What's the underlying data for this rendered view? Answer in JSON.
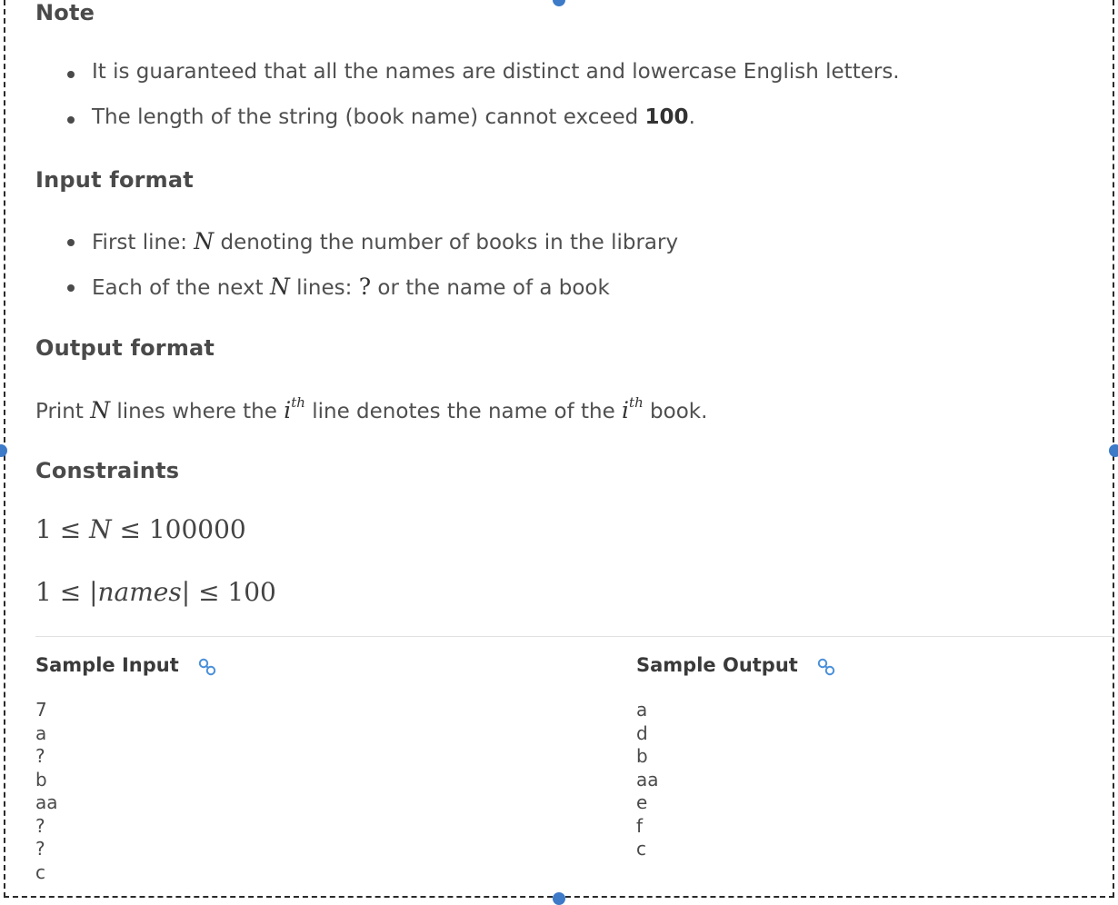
{
  "note": {
    "heading": "Note",
    "bullets": [
      "It is guaranteed that all the names are distinct and lowercase English letters.",
      "The length of the string (book name) cannot exceed "
    ],
    "bullet2_bold": "100",
    "bullet2_end": "."
  },
  "input_format": {
    "heading": "Input format",
    "line1_pre": "First line: ",
    "line1_var": "N",
    "line1_post": " denoting the number of books in the library",
    "line2_pre": "Each of the next ",
    "line2_var": "N",
    "line2_mid": " lines: ",
    "line2_q": "?",
    "line2_post": " or the name of a book"
  },
  "output_format": {
    "heading": "Output format",
    "p1": "Print ",
    "var": "N",
    "p2": " lines where the ",
    "i1": "i",
    "sup1": "th",
    "p3": " line denotes the name of the ",
    "i2": "i",
    "sup2": "th",
    "p4": " book."
  },
  "constraints": {
    "heading": "Constraints",
    "c1_a": "1 ≤ ",
    "c1_var": "N",
    "c1_b": " ≤ 100000",
    "c2_a": "1 ≤ |",
    "c2_var": "names",
    "c2_b": "| ≤ 100"
  },
  "sample_input": {
    "title": "Sample Input",
    "lines": [
      "7",
      "a",
      "?",
      "b",
      "aa",
      "?",
      "?",
      "c"
    ]
  },
  "sample_output": {
    "title": "Sample Output",
    "lines": [
      "a",
      "d",
      "b",
      "aa",
      "e",
      "f",
      "c"
    ]
  },
  "icons": {
    "permalink": "link-icon"
  },
  "colors": {
    "handle": "#3d7ac8",
    "link": "#4a90d9"
  }
}
